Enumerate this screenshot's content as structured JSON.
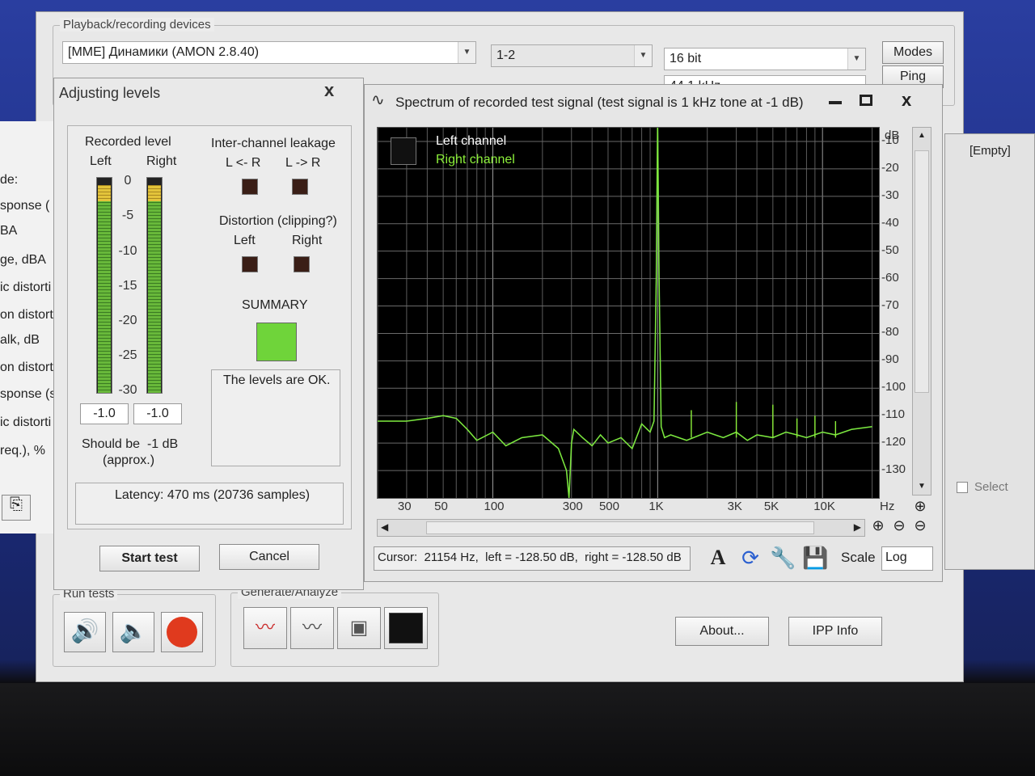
{
  "colors": {
    "desktop": "#1d2f8a",
    "plot_bg": "#000000",
    "left_trace": "#59d04a",
    "right_trace": "#8cf03a",
    "summary_ok": "#6fd43a"
  },
  "main": {
    "group_title": "Playback/recording devices",
    "device": "[MME] Динамики (AMON 2.8.40)",
    "channels": "1-2",
    "bits": "16 bit",
    "rate": "44.1 kHz",
    "modes_label": "Modes",
    "ping_label": "Ping",
    "empty_label": "[Empty]",
    "select_label": "Select",
    "run_tests_title": "Run tests",
    "generate_title": "Generate/Analyze",
    "about_label": "About...",
    "ipp_label": "IPP Info"
  },
  "left_window": {
    "items": [
      "de:",
      "sponse (",
      "BA",
      "ge, dBA",
      "ic distorti",
      "on distorti",
      "alk, dB",
      "on distorti",
      "sponse (s",
      "ic distorti",
      "req.), %"
    ]
  },
  "levels": {
    "title": "Adjusting levels",
    "close": "x",
    "recorded_level": "Recorded level",
    "left": "Left",
    "right": "Right",
    "scale": [
      "0",
      "-5",
      "-10",
      "-15",
      "-20",
      "-25",
      "-30"
    ],
    "left_value": "-1.0",
    "right_value": "-1.0",
    "should_be": "Should be  -1 dB",
    "approx": "(approx.)",
    "leakage_title": "Inter-channel leakage",
    "leak_lr": "L <- R",
    "leak_rl": "L -> R",
    "distortion_title": "Distortion (clipping?)",
    "dist_left": "Left",
    "dist_right": "Right",
    "summary": "SUMMARY",
    "summary_text": "The levels are OK.",
    "latency": "Latency: 470 ms (20736 samples)",
    "start_label": "Start test",
    "cancel_label": "Cancel",
    "left_level_db": -1.0,
    "right_level_db": -1.0
  },
  "spectrum": {
    "title": "Spectrum of recorded test signal (test signal is 1 kHz tone at -1 dB)",
    "legend_left": "Left channel",
    "legend_right": "Right channel",
    "cursor": "Cursor:  21154 Hz,  left = -128.50 dB,  right = -128.50 dB",
    "scale_label": "Scale",
    "scale_value": "Log",
    "tool_text": "A"
  },
  "chart_data": {
    "type": "line",
    "title": "Spectrum of recorded test signal (test signal is 1 kHz tone at -1 dB)",
    "xlabel": "Hz",
    "ylabel": "dB",
    "x_scale": "log",
    "xlim": [
      20,
      22000
    ],
    "ylim": [
      -140,
      -5
    ],
    "x_ticks": [
      {
        "v": 30,
        "l": "30"
      },
      {
        "v": 50,
        "l": "50"
      },
      {
        "v": 100,
        "l": "100"
      },
      {
        "v": 300,
        "l": "300"
      },
      {
        "v": 500,
        "l": "500"
      },
      {
        "v": 1000,
        "l": "1K"
      },
      {
        "v": 3000,
        "l": "3K"
      },
      {
        "v": 5000,
        "l": "5K"
      },
      {
        "v": 10000,
        "l": "10K"
      }
    ],
    "y_ticks": [
      -10,
      -20,
      -30,
      -40,
      -50,
      -60,
      -70,
      -80,
      -90,
      -100,
      -110,
      -120,
      -130
    ],
    "series": [
      {
        "name": "Left channel",
        "x": [
          20,
          30,
          40,
          50,
          60,
          70,
          80,
          100,
          120,
          150,
          200,
          250,
          280,
          290,
          300,
          310,
          350,
          400,
          450,
          500,
          600,
          700,
          800,
          900,
          950,
          980,
          1000,
          1020,
          1050,
          1100,
          1200,
          1500,
          2000,
          2500,
          3000,
          3500,
          4000,
          5000,
          6000,
          7000,
          8000,
          10000,
          12000,
          15000,
          20000
        ],
        "y": [
          -112,
          -112,
          -111,
          -110,
          -111,
          -115,
          -119,
          -116,
          -121,
          -118,
          -117,
          -122,
          -130,
          -140,
          -120,
          -115,
          -118,
          -121,
          -117,
          -120,
          -118,
          -122,
          -113,
          -116,
          -112,
          -60,
          -2,
          -60,
          -114,
          -118,
          -117,
          -119,
          -116,
          -118,
          -116,
          -119,
          -117,
          -118,
          -116,
          -117,
          -118,
          -116,
          -117,
          -115,
          -114
        ]
      },
      {
        "name": "Right channel",
        "x": [
          20,
          30,
          40,
          50,
          60,
          70,
          80,
          100,
          120,
          150,
          200,
          250,
          280,
          290,
          300,
          310,
          350,
          400,
          450,
          500,
          600,
          700,
          800,
          900,
          950,
          980,
          1000,
          1020,
          1050,
          1100,
          1200,
          1500,
          2000,
          2500,
          3000,
          3500,
          4000,
          5000,
          6000,
          7000,
          8000,
          10000,
          12000,
          15000,
          20000
        ],
        "y": [
          -112,
          -112,
          -111,
          -110,
          -111,
          -115,
          -119,
          -116,
          -121,
          -118,
          -117,
          -122,
          -130,
          -140,
          -120,
          -115,
          -118,
          -121,
          -117,
          -120,
          -118,
          -122,
          -113,
          -116,
          -112,
          -60,
          -2,
          -60,
          -114,
          -118,
          -117,
          -119,
          -116,
          -118,
          -116,
          -119,
          -117,
          -118,
          -116,
          -117,
          -118,
          -116,
          -117,
          -115,
          -114
        ]
      }
    ],
    "spikes": [
      {
        "x": 1600,
        "y": -108
      },
      {
        "x": 3000,
        "y": -105
      },
      {
        "x": 5000,
        "y": -106
      },
      {
        "x": 7000,
        "y": -111
      },
      {
        "x": 9000,
        "y": -110
      },
      {
        "x": 12000,
        "y": -112
      }
    ]
  }
}
